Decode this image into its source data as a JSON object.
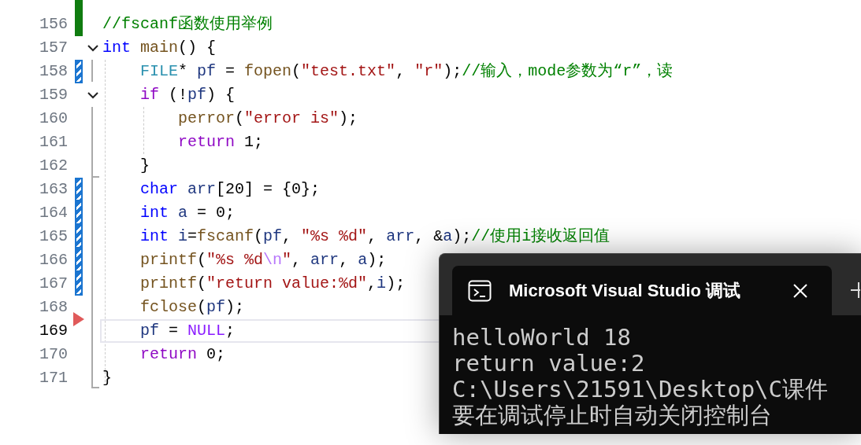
{
  "editor": {
    "lines": [
      {
        "saved": true
      },
      {
        "number": "156",
        "saved": true,
        "tokens": [
          {
            "kind": "comment",
            "text": "//fscanf函数使用举例"
          }
        ]
      },
      {
        "number": "157",
        "expanded": true,
        "tokens": [
          {
            "kind": "keyword",
            "text": "int"
          },
          {
            "kind": "function",
            "text": " main"
          },
          {
            "kind": "plain",
            "text": "() {"
          }
        ]
      },
      {
        "number": "158",
        "modified": true,
        "tokens": [
          {
            "kind": "type",
            "text": "    FILE"
          },
          {
            "kind": "plain",
            "text": "* "
          },
          {
            "kind": "variable",
            "text": "pf"
          },
          {
            "kind": "plain",
            "text": " = "
          },
          {
            "kind": "function",
            "text": "fopen"
          },
          {
            "kind": "plain",
            "text": "("
          },
          {
            "kind": "string",
            "text": "\"test.txt\""
          },
          {
            "kind": "plain",
            "text": ", "
          },
          {
            "kind": "string",
            "text": "\"r\""
          },
          {
            "kind": "plain",
            "text": ");"
          },
          {
            "kind": "comment",
            "text": "//输入，mode参数为“r”，读"
          }
        ]
      },
      {
        "number": "159",
        "expanded": true,
        "tokens": [
          {
            "kind": "control",
            "text": "    if"
          },
          {
            "kind": "plain",
            "text": " (!"
          },
          {
            "kind": "variable",
            "text": "pf"
          },
          {
            "kind": "plain",
            "text": ") {"
          }
        ]
      },
      {
        "number": "160",
        "tokens": [
          {
            "kind": "function",
            "text": "        perror"
          },
          {
            "kind": "plain",
            "text": "("
          },
          {
            "kind": "string",
            "text": "\"error is\""
          },
          {
            "kind": "plain",
            "text": ");"
          }
        ]
      },
      {
        "number": "161",
        "tokens": [
          {
            "kind": "control",
            "text": "        return"
          },
          {
            "kind": "plain",
            "text": " 1;"
          }
        ]
      },
      {
        "number": "162",
        "tokens": [
          {
            "kind": "plain",
            "text": "    }"
          }
        ]
      },
      {
        "number": "163",
        "modified": true,
        "tokens": [
          {
            "kind": "keyword",
            "text": "    char"
          },
          {
            "kind": "variable",
            "text": " arr"
          },
          {
            "kind": "plain",
            "text": "[20] = {0};"
          }
        ]
      },
      {
        "number": "164",
        "modified": true,
        "tokens": [
          {
            "kind": "keyword",
            "text": "    int"
          },
          {
            "kind": "variable",
            "text": " a"
          },
          {
            "kind": "plain",
            "text": " = 0;"
          }
        ]
      },
      {
        "number": "165",
        "modified": true,
        "tokens": [
          {
            "kind": "keyword",
            "text": "    int"
          },
          {
            "kind": "variable",
            "text": " i"
          },
          {
            "kind": "plain",
            "text": "="
          },
          {
            "kind": "function",
            "text": "fscanf"
          },
          {
            "kind": "plain",
            "text": "("
          },
          {
            "kind": "variable",
            "text": "pf"
          },
          {
            "kind": "plain",
            "text": ", "
          },
          {
            "kind": "string",
            "text": "\"%s %d\""
          },
          {
            "kind": "plain",
            "text": ", "
          },
          {
            "kind": "variable",
            "text": "arr"
          },
          {
            "kind": "plain",
            "text": ", &"
          },
          {
            "kind": "variable",
            "text": "a"
          },
          {
            "kind": "plain",
            "text": ");"
          },
          {
            "kind": "comment",
            "text": "//使用i接收返回值"
          }
        ]
      },
      {
        "number": "166",
        "modified": true,
        "tokens": [
          {
            "kind": "function",
            "text": "    printf"
          },
          {
            "kind": "plain",
            "text": "("
          },
          {
            "kind": "string",
            "text": "\"%s %d"
          },
          {
            "kind": "escape",
            "text": "\\n"
          },
          {
            "kind": "string",
            "text": "\""
          },
          {
            "kind": "plain",
            "text": ", "
          },
          {
            "kind": "variable",
            "text": "arr"
          },
          {
            "kind": "plain",
            "text": ", "
          },
          {
            "kind": "variable",
            "text": "a"
          },
          {
            "kind": "plain",
            "text": ");"
          }
        ]
      },
      {
        "number": "167",
        "modified": true,
        "tokens": [
          {
            "kind": "function",
            "text": "    printf"
          },
          {
            "kind": "plain",
            "text": "("
          },
          {
            "kind": "string",
            "text": "\"return value:%d\""
          },
          {
            "kind": "plain",
            "text": ","
          },
          {
            "kind": "variable",
            "text": "i"
          },
          {
            "kind": "plain",
            "text": ");"
          }
        ]
      },
      {
        "number": "168",
        "tokens": [
          {
            "kind": "function",
            "text": "    fclose"
          },
          {
            "kind": "plain",
            "text": "("
          },
          {
            "kind": "variable",
            "text": "pf"
          },
          {
            "kind": "plain",
            "text": ");"
          }
        ]
      },
      {
        "number": "169",
        "current": true,
        "tokens": [
          {
            "kind": "variable",
            "text": "    pf"
          },
          {
            "kind": "plain",
            "text": " = "
          },
          {
            "kind": "macro",
            "text": "NULL"
          },
          {
            "kind": "plain",
            "text": ";"
          }
        ]
      },
      {
        "number": "170",
        "tokens": [
          {
            "kind": "control",
            "text": "    return"
          },
          {
            "kind": "plain",
            "text": " 0;"
          }
        ]
      },
      {
        "number": "171",
        "tokens": [
          {
            "kind": "plain",
            "text": "}"
          }
        ]
      }
    ]
  },
  "console": {
    "tab_title": "Microsoft Visual Studio 调试",
    "output": [
      "helloWorld 18",
      "return value:2",
      "C:\\Users\\21591\\Desktop\\C课件",
      "要在调试停止时自动关闭控制台"
    ]
  }
}
